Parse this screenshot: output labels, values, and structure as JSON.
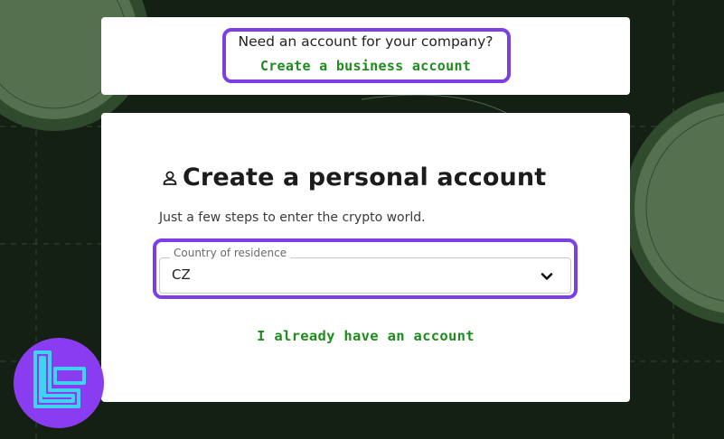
{
  "business_card": {
    "question": "Need an account for your company?",
    "link": "Create a business account"
  },
  "personal_card": {
    "title": "Create a personal account",
    "subtitle": "Just a few steps to enter the crypto world.",
    "country_field": {
      "label": "Country of residence",
      "value": "CZ"
    },
    "login_link": "I already have an account"
  },
  "colors": {
    "accent_link": "#1d8c1d",
    "highlight": "#7b3fe4",
    "background": "#142014",
    "logo_bg": "#8a3df0",
    "logo_stroke": "#3fd3f0"
  },
  "icons": [
    "person-icon",
    "chevron-down-icon",
    "brand-logo"
  ]
}
